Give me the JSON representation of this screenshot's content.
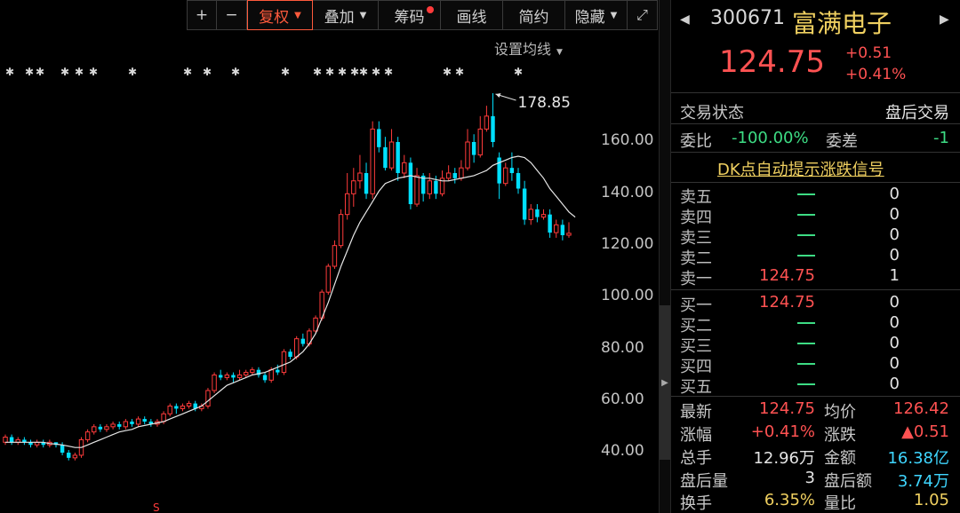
{
  "toolbar": {
    "plus_label": "+",
    "minus_label": "−",
    "restore_label": "复权",
    "overlay_label": "叠加",
    "chips_label": "筹码",
    "draw_label": "画线",
    "review_label": "简约",
    "hide_label": "隐藏",
    "expand_icon": "expand-icon"
  },
  "chart": {
    "avg_line_setting": "设置均线",
    "peak_label": "178.85",
    "y_ticks": [
      "160.00",
      "140.00",
      "120.00",
      "100.00",
      "80.00",
      "60.00",
      "40.00"
    ],
    "up_color": "#ff3b3b",
    "down_color": "#00e0ff",
    "ma_color": "#e6e6e6"
  },
  "chart_data": {
    "type": "candlestick",
    "ylim": [
      35,
      180
    ],
    "y_ticks": [
      160,
      140,
      120,
      100,
      80,
      60,
      40
    ],
    "peak": 178.85,
    "candles": [
      {
        "o": 44,
        "c": 46,
        "h": 47,
        "l": 43
      },
      {
        "o": 46,
        "c": 44,
        "h": 47,
        "l": 43
      },
      {
        "o": 44,
        "c": 45,
        "h": 46,
        "l": 43
      },
      {
        "o": 45,
        "c": 44,
        "h": 46,
        "l": 43
      },
      {
        "o": 44,
        "c": 43,
        "h": 45,
        "l": 42
      },
      {
        "o": 43,
        "c": 44,
        "h": 45,
        "l": 42
      },
      {
        "o": 44,
        "c": 43,
        "h": 45,
        "l": 42
      },
      {
        "o": 43,
        "c": 44,
        "h": 45,
        "l": 42
      },
      {
        "o": 44,
        "c": 43,
        "h": 44,
        "l": 42
      },
      {
        "o": 43,
        "c": 40,
        "h": 44,
        "l": 39
      },
      {
        "o": 40,
        "c": 38,
        "h": 41,
        "l": 37
      },
      {
        "o": 38,
        "c": 39,
        "h": 40,
        "l": 37
      },
      {
        "o": 39,
        "c": 45,
        "h": 46,
        "l": 38
      },
      {
        "o": 45,
        "c": 48,
        "h": 49,
        "l": 44
      },
      {
        "o": 48,
        "c": 50,
        "h": 51,
        "l": 47
      },
      {
        "o": 50,
        "c": 49,
        "h": 51,
        "l": 48
      },
      {
        "o": 49,
        "c": 50,
        "h": 51,
        "l": 48
      },
      {
        "o": 50,
        "c": 51,
        "h": 52,
        "l": 49
      },
      {
        "o": 51,
        "c": 50,
        "h": 52,
        "l": 49
      },
      {
        "o": 50,
        "c": 52,
        "h": 53,
        "l": 49
      },
      {
        "o": 52,
        "c": 51,
        "h": 53,
        "l": 50
      },
      {
        "o": 51,
        "c": 53,
        "h": 54,
        "l": 50
      },
      {
        "o": 53,
        "c": 52,
        "h": 54,
        "l": 51
      },
      {
        "o": 52,
        "c": 51,
        "h": 53,
        "l": 50
      },
      {
        "o": 51,
        "c": 52,
        "h": 53,
        "l": 50
      },
      {
        "o": 52,
        "c": 55,
        "h": 56,
        "l": 51
      },
      {
        "o": 55,
        "c": 58,
        "h": 59,
        "l": 54
      },
      {
        "o": 58,
        "c": 57,
        "h": 59,
        "l": 55
      },
      {
        "o": 57,
        "c": 58,
        "h": 59,
        "l": 56
      },
      {
        "o": 58,
        "c": 59,
        "h": 60,
        "l": 57
      },
      {
        "o": 59,
        "c": 57,
        "h": 60,
        "l": 56
      },
      {
        "o": 57,
        "c": 58,
        "h": 59,
        "l": 56
      },
      {
        "o": 58,
        "c": 64,
        "h": 65,
        "l": 57
      },
      {
        "o": 64,
        "c": 70,
        "h": 71,
        "l": 63
      },
      {
        "o": 70,
        "c": 69,
        "h": 72,
        "l": 68
      },
      {
        "o": 69,
        "c": 70,
        "h": 71,
        "l": 68
      },
      {
        "o": 70,
        "c": 69,
        "h": 71,
        "l": 67
      },
      {
        "o": 69,
        "c": 70,
        "h": 72,
        "l": 68
      },
      {
        "o": 70,
        "c": 71,
        "h": 72,
        "l": 69
      },
      {
        "o": 71,
        "c": 72,
        "h": 73,
        "l": 70
      },
      {
        "o": 72,
        "c": 70,
        "h": 73,
        "l": 69
      },
      {
        "o": 70,
        "c": 68,
        "h": 71,
        "l": 67
      },
      {
        "o": 68,
        "c": 72,
        "h": 73,
        "l": 67
      },
      {
        "o": 72,
        "c": 71,
        "h": 74,
        "l": 70
      },
      {
        "o": 71,
        "c": 79,
        "h": 80,
        "l": 70
      },
      {
        "o": 79,
        "c": 77,
        "h": 80,
        "l": 76
      },
      {
        "o": 77,
        "c": 84,
        "h": 85,
        "l": 76
      },
      {
        "o": 84,
        "c": 82,
        "h": 86,
        "l": 81
      },
      {
        "o": 82,
        "c": 87,
        "h": 88,
        "l": 81
      },
      {
        "o": 87,
        "c": 92,
        "h": 93,
        "l": 86
      },
      {
        "o": 92,
        "c": 102,
        "h": 103,
        "l": 91
      },
      {
        "o": 102,
        "c": 112,
        "h": 113,
        "l": 101
      },
      {
        "o": 112,
        "c": 120,
        "h": 122,
        "l": 111
      },
      {
        "o": 120,
        "c": 132,
        "h": 134,
        "l": 119
      },
      {
        "o": 132,
        "c": 140,
        "h": 148,
        "l": 130
      },
      {
        "o": 140,
        "c": 145,
        "h": 150,
        "l": 135
      },
      {
        "o": 145,
        "c": 148,
        "h": 155,
        "l": 142
      },
      {
        "o": 148,
        "c": 140,
        "h": 152,
        "l": 138
      },
      {
        "o": 140,
        "c": 165,
        "h": 168,
        "l": 138
      },
      {
        "o": 165,
        "c": 158,
        "h": 168,
        "l": 156
      },
      {
        "o": 158,
        "c": 150,
        "h": 162,
        "l": 149
      },
      {
        "o": 150,
        "c": 160,
        "h": 165,
        "l": 149
      },
      {
        "o": 160,
        "c": 148,
        "h": 162,
        "l": 145
      },
      {
        "o": 148,
        "c": 152,
        "h": 155,
        "l": 146
      },
      {
        "o": 152,
        "c": 136,
        "h": 154,
        "l": 134
      },
      {
        "o": 136,
        "c": 147,
        "h": 150,
        "l": 135
      },
      {
        "o": 147,
        "c": 140,
        "h": 148,
        "l": 137
      },
      {
        "o": 140,
        "c": 145,
        "h": 148,
        "l": 138
      },
      {
        "o": 145,
        "c": 140,
        "h": 147,
        "l": 138
      },
      {
        "o": 140,
        "c": 146,
        "h": 149,
        "l": 139
      },
      {
        "o": 146,
        "c": 148,
        "h": 151,
        "l": 145
      },
      {
        "o": 148,
        "c": 146,
        "h": 150,
        "l": 144
      },
      {
        "o": 146,
        "c": 150,
        "h": 153,
        "l": 145
      },
      {
        "o": 150,
        "c": 160,
        "h": 165,
        "l": 149
      },
      {
        "o": 160,
        "c": 155,
        "h": 163,
        "l": 152
      },
      {
        "o": 155,
        "c": 165,
        "h": 170,
        "l": 154
      },
      {
        "o": 165,
        "c": 170,
        "h": 174,
        "l": 164
      },
      {
        "o": 170,
        "c": 160,
        "h": 178.85,
        "l": 158
      },
      {
        "o": 154,
        "c": 144,
        "h": 156,
        "l": 138
      },
      {
        "o": 144,
        "c": 150,
        "h": 152,
        "l": 143
      },
      {
        "o": 150,
        "c": 148,
        "h": 156,
        "l": 145
      },
      {
        "o": 148,
        "c": 142,
        "h": 150,
        "l": 140
      },
      {
        "o": 142,
        "c": 130,
        "h": 145,
        "l": 128
      },
      {
        "o": 130,
        "c": 134,
        "h": 136,
        "l": 128
      },
      {
        "o": 134,
        "c": 131,
        "h": 136,
        "l": 129
      },
      {
        "o": 131,
        "c": 132,
        "h": 134,
        "l": 130
      },
      {
        "o": 132,
        "c": 125,
        "h": 134,
        "l": 123
      },
      {
        "o": 125,
        "c": 128,
        "h": 130,
        "l": 123
      },
      {
        "o": 128,
        "c": 124,
        "h": 130,
        "l": 122
      },
      {
        "o": 124,
        "c": 124.75,
        "h": 129,
        "l": 123
      }
    ],
    "ma": [
      44,
      44,
      44,
      44,
      44,
      44,
      44,
      43.5,
      43.3,
      43,
      42.5,
      42,
      42,
      43,
      44,
      45,
      46,
      47,
      48,
      48.5,
      49,
      50,
      50.5,
      51,
      51.5,
      52,
      53,
      54,
      55,
      56,
      57,
      58,
      60,
      62,
      64,
      66,
      67,
      68,
      69,
      70,
      70.5,
      71,
      72,
      73,
      74,
      75,
      77,
      79,
      82,
      86,
      92,
      98,
      105,
      112,
      118,
      124,
      129,
      133,
      137,
      141,
      144,
      145,
      146,
      146.5,
      147,
      146.5,
      146,
      146,
      145.5,
      145,
      145,
      145.5,
      146,
      146.5,
      147,
      148,
      149,
      151,
      152,
      153,
      154,
      154.5,
      154,
      152,
      149,
      146,
      142,
      139,
      136,
      133,
      131
    ]
  },
  "panel": {
    "stock_code": "300671",
    "stock_name": "富满电子",
    "price": "124.75",
    "change_abs": "+0.51",
    "change_pct": "+0.41%",
    "trade_status_label": "交易状态",
    "trade_status_value": "盘后交易",
    "wb_label": "委比",
    "wb_value": "-100.00%",
    "wc_label": "委差",
    "wc_value": "-1",
    "dk_link": "DK点自动提示涨跌信号",
    "sell": [
      {
        "label": "卖五",
        "price": "",
        "vol": "0"
      },
      {
        "label": "卖四",
        "price": "",
        "vol": "0"
      },
      {
        "label": "卖三",
        "price": "",
        "vol": "0"
      },
      {
        "label": "卖二",
        "price": "",
        "vol": "0"
      },
      {
        "label": "卖一",
        "price": "124.75",
        "vol": "1"
      }
    ],
    "buy": [
      {
        "label": "买一",
        "price": "124.75",
        "vol": "0"
      },
      {
        "label": "买二",
        "price": "",
        "vol": "0"
      },
      {
        "label": "买三",
        "price": "",
        "vol": "0"
      },
      {
        "label": "买四",
        "price": "",
        "vol": "0"
      },
      {
        "label": "买五",
        "price": "",
        "vol": "0"
      }
    ],
    "stats": {
      "latest_label": "最新",
      "latest_value": "124.75",
      "avg_label": "均价",
      "avg_value": "126.42",
      "amp_label": "涨幅",
      "amp_value": "+0.41%",
      "chg_label": "涨跌",
      "chg_value": "▲0.51",
      "vol_label": "总手",
      "vol_value": "12.96万",
      "amt_label": "金额",
      "amt_value": "16.38亿",
      "ah_vol_label": "盘后量",
      "ah_vol_value": "3",
      "ah_amt_label": "盘后额",
      "ah_amt_value": "3.74万",
      "turnover_label": "换手",
      "turnover_value": "6.35%",
      "ratio_label": "量比",
      "ratio_value": "1.05"
    }
  }
}
